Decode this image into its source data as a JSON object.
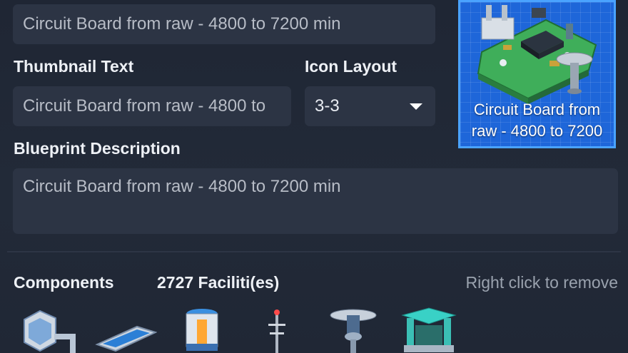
{
  "form": {
    "name_value": "Circuit Board from raw - 4800 to 7200 min",
    "thumbnail_text_label": "Thumbnail Text",
    "thumbnail_text_value": "Circuit Board from raw - 4800 to",
    "icon_layout_label": "Icon Layout",
    "icon_layout_value": "3-3",
    "description_label": "Blueprint Description",
    "description_value": "Circuit Board from raw - 4800 to 7200 min"
  },
  "thumbnail": {
    "caption_line1": "Circuit Board from",
    "caption_line2": "raw - 4800 to 7200",
    "background_color": "#1e66d9",
    "border_color": "#4aa3ff"
  },
  "components": {
    "label": "Components",
    "count": "2727 Faciliti(es)",
    "hint": "Right click to remove",
    "icons": [
      "smelter-icon",
      "conveyor-belt-icon",
      "storage-tank-icon",
      "wind-turbine-icon",
      "logistics-station-icon",
      "assembler-icon"
    ]
  },
  "colors": {
    "background": "#222a38",
    "field": "#2c3444",
    "text_muted": "#b7bcc6"
  }
}
